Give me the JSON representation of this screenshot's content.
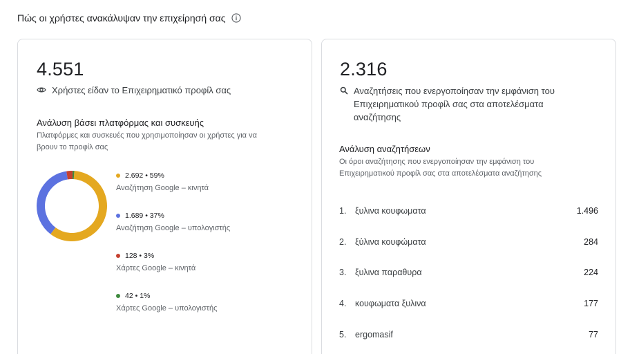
{
  "header": {
    "title": "Πώς οι χρήστες ανακάλυψαν την επιχείρησή σας",
    "info_icon": "info-icon"
  },
  "profile_views": {
    "total": "4.551",
    "icon": "eye-icon",
    "description": "Χρήστες είδαν το Επιχειρηματικό προφίλ σας"
  },
  "platform_breakdown": {
    "title": "Ανάλυση βάσει πλατφόρμας και συσκευής",
    "subtitle_line1": "Πλατφόρμες και συσκευές που χρησιμοποίησαν οι χρήστες για να",
    "subtitle_line2": "βρουν το προφίλ σας",
    "items": [
      {
        "value": "2.692 • 59%",
        "label": "Αναζήτηση Google – κινητά",
        "color": "#E4A820",
        "share": 59.15
      },
      {
        "value": "1.689 • 37%",
        "label": "Αναζήτηση Google – υπολογιστής",
        "color": "#5C72E0",
        "share": 37.11
      },
      {
        "value": "128 • 3%",
        "label": "Χάρτες Google – κινητά",
        "color": "#C5402F",
        "share": 2.81
      },
      {
        "value": "42 • 1%",
        "label": "Χάρτες Google – υπολογιστής",
        "color": "#3E8A3E",
        "share": 0.93
      }
    ]
  },
  "searches": {
    "total": "2.316",
    "icon": "search-icon",
    "description_line1": "Αναζητήσεις που ενεργοποίησαν την εμφάνιση του",
    "description_line2": "Επιχειρηματικού προφίλ σας στα αποτελέσματα",
    "description_line3": "αναζήτησης"
  },
  "search_breakdown": {
    "title": "Ανάλυση αναζητήσεων",
    "subtitle_line1": "Οι όροι αναζήτησης που ενεργοποίησαν την εμφάνιση του",
    "subtitle_line2": "Επιχειρηματικού προφίλ σας στα αποτελέσματα αναζήτησης",
    "terms": [
      {
        "rank": "1.",
        "term": "ξυλινα κουφωματα",
        "count": "1.496"
      },
      {
        "rank": "2.",
        "term": "ξύλινα κουφώματα",
        "count": "284"
      },
      {
        "rank": "3.",
        "term": "ξυλινα παραθυρα",
        "count": "224"
      },
      {
        "rank": "4.",
        "term": "κουφωματα ξυλινα",
        "count": "177"
      },
      {
        "rank": "5.",
        "term": "ergomasif",
        "count": "77"
      }
    ]
  }
}
